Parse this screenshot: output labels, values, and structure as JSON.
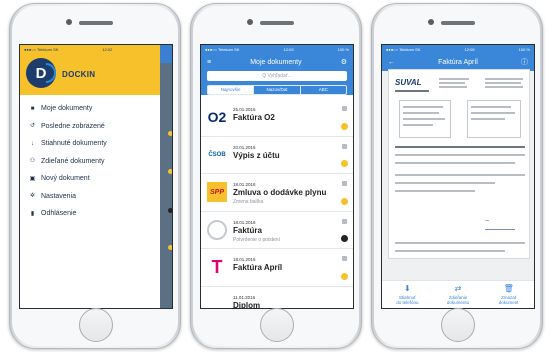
{
  "phone1": {
    "status": {
      "carrier": "●●●○○ Telekom SK",
      "time": "12:02"
    },
    "brand": "DOCKIN",
    "logo_letter": "D",
    "menu": [
      {
        "icon": "folder-icon",
        "glyph": "■",
        "label": "Moje dokumenty"
      },
      {
        "icon": "history-icon",
        "glyph": "↺",
        "label": "Posledne zobrazené"
      },
      {
        "icon": "download-icon",
        "glyph": "↓",
        "label": "Stiahnuté dokumenty"
      },
      {
        "icon": "shared-icon",
        "glyph": "⚇",
        "label": "Zdieľané dokumenty"
      },
      {
        "icon": "new-document-icon",
        "glyph": "▣",
        "label": "Nový dokument"
      },
      {
        "icon": "gear-icon",
        "glyph": "✲",
        "label": "Nastavenia"
      },
      {
        "icon": "logout-icon",
        "glyph": "▮",
        "label": "Odhlásenie"
      }
    ]
  },
  "phone2": {
    "status": {
      "carrier": "●●●○○ Telekom SK",
      "time": "12:03",
      "battery": "100 %"
    },
    "title": "Moje dokumenty",
    "search_placeholder": "Q  Vyhľadať...",
    "tabs": [
      "Najnovšie",
      "Nazov/Dat",
      "ABC"
    ],
    "active_tab": 0,
    "documents": [
      {
        "logo": "O2",
        "date": "25.01.2016",
        "title": "Faktúra O2",
        "subtitle": "",
        "dot": "#f6c12b"
      },
      {
        "logo": "ČSOB",
        "date": "20.01.2016",
        "title": "Výpis z účtu",
        "subtitle": "",
        "dot": "#f6c12b"
      },
      {
        "logo": "SPP",
        "date": "18.01.2016",
        "title": "Zmluva o dodávke plynu",
        "subtitle": "Zmena balíka",
        "dot": "#f6c12b"
      },
      {
        "logo": "",
        "date": "18.01.2016",
        "title": "Faktúra",
        "subtitle": "Potvrdenie o poistení",
        "dot": "#222222"
      },
      {
        "logo": "T",
        "date": "18.01.2016",
        "title": "Faktúra Apríl",
        "subtitle": "",
        "dot": "#f6c12b"
      },
      {
        "logo": "",
        "date": "11.01.2016",
        "title": "Diplom",
        "subtitle": "",
        "dot": ""
      }
    ]
  },
  "phone3": {
    "status": {
      "carrier": "●●●○○ Telekom SK",
      "time": "12:05",
      "battery": "100 %"
    },
    "title": "Faktúra Apríl",
    "company": "SUVAL",
    "actions": [
      {
        "icon": "download-icon",
        "glyph": "⬇",
        "label_lines": [
          "Stiahnuť",
          "do telefónu"
        ]
      },
      {
        "icon": "share-icon",
        "glyph": "⇄",
        "label_lines": [
          "Zdieľanie",
          "dokumentu"
        ]
      },
      {
        "icon": "trash-icon",
        "glyph": "🗑",
        "label_lines": [
          "Zmazať",
          "dokument"
        ]
      }
    ]
  },
  "colors": {
    "yellow": "#f6c12b",
    "blue": "#3a86d8",
    "navy": "#1d3d6e"
  }
}
